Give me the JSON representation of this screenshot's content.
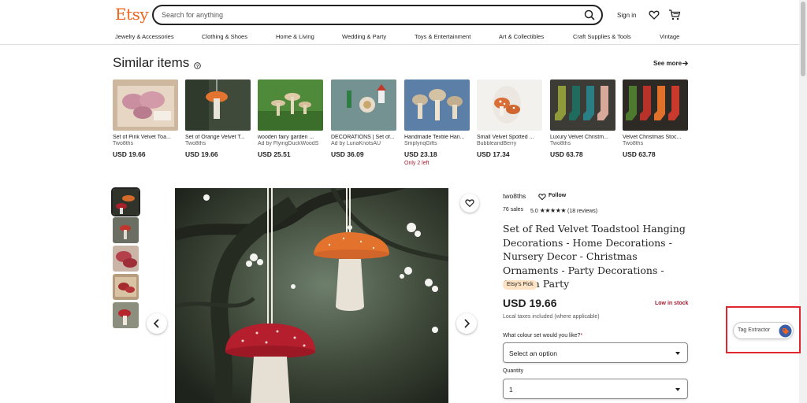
{
  "header": {
    "logo": "Etsy",
    "search_placeholder": "Search for anything",
    "sign_in": "Sign in",
    "categories": [
      "Jewelry & Accessories",
      "Clothing & Shoes",
      "Home & Living",
      "Wedding & Party",
      "Toys & Entertainment",
      "Art & Collectibles",
      "Craft Supplies & Tools",
      "Vintage"
    ]
  },
  "similar": {
    "title": "Similar items",
    "see_more": "See more",
    "items": [
      {
        "title": "Set of Pink Velvet Toa...",
        "shop": "Two8ths",
        "price": "USD 19.66",
        "stock": ""
      },
      {
        "title": "Set of Orange Velvet T...",
        "shop": "Two8ths",
        "price": "USD 19.66",
        "stock": ""
      },
      {
        "title": "wooden fairy garden ...",
        "shop": "Ad by FlyingDuckWoodS",
        "price": "USD 25.51",
        "stock": ""
      },
      {
        "title": "DECORATIONS | Set of...",
        "shop": "Ad by LunaKnotsAU",
        "price": "USD 36.09",
        "stock": ""
      },
      {
        "title": "Handmade Textile Han...",
        "shop": "SmplynqGifts",
        "price": "USD 23.18",
        "stock": "Only 2 left"
      },
      {
        "title": "Small Velvet Spotted ...",
        "shop": "BubbleandBerry",
        "price": "USD 17.34",
        "stock": ""
      },
      {
        "title": "Luxury Velvet Christm...",
        "shop": "Two8ths",
        "price": "USD 63.78",
        "stock": ""
      },
      {
        "title": "Velvet Christmas Stoc...",
        "shop": "Two8ths",
        "price": "USD 63.78",
        "stock": ""
      }
    ]
  },
  "product": {
    "shop": "two8ths",
    "follow": "Follow",
    "sales": "76 sales",
    "rating_value": "5.0",
    "stars": "★★★★★",
    "reviews": "(18 reviews)",
    "title": "Set of Red Velvet Toadstool Hanging Decorations - Home Decorations - Nursery Decor - Christmas Ornaments - Party Decorations - Garden Party",
    "badge": "Etsy's Pick",
    "price": "USD 19.66",
    "low_stock": "Low in stock",
    "tax_note": "Local taxes included (where applicable)",
    "colour_label": "What colour set would you like?",
    "colour_required": "*",
    "colour_value": "Select an option",
    "quantity_label": "Quantity",
    "quantity_value": "1"
  },
  "extension": {
    "label": "Tag Extractor"
  },
  "colors": {
    "brand": "#f1641e",
    "alert": "#a61a2e",
    "badge_bg": "#fde3c4",
    "highlight_box": "#e0262f"
  }
}
